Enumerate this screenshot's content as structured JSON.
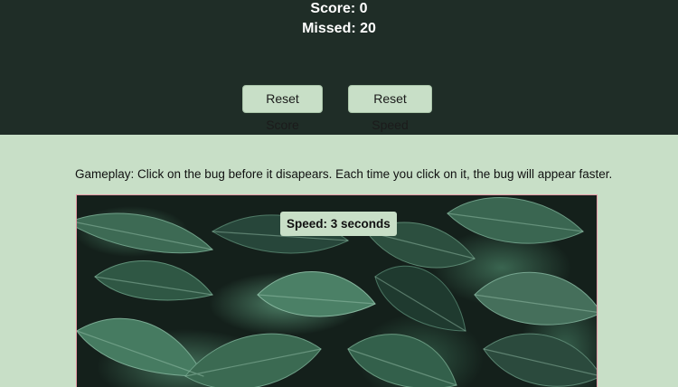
{
  "stats": {
    "score_text": "Score: 0",
    "missed_text": "Missed: 20"
  },
  "controls": {
    "reset_score_label": "Reset Score",
    "reset_speed_label": "Reset Speed"
  },
  "instructions": "Gameplay: Click on the bug before it disapears. Each time you click on it, the bug will appear faster.",
  "game_board": {
    "background": "tropical leaves photo",
    "speed_text": "Speed: 3 seconds"
  },
  "colors": {
    "header_bg": "#1f2d27",
    "page_bg": "#c8dfc7",
    "board_border": "#e59aa6"
  }
}
